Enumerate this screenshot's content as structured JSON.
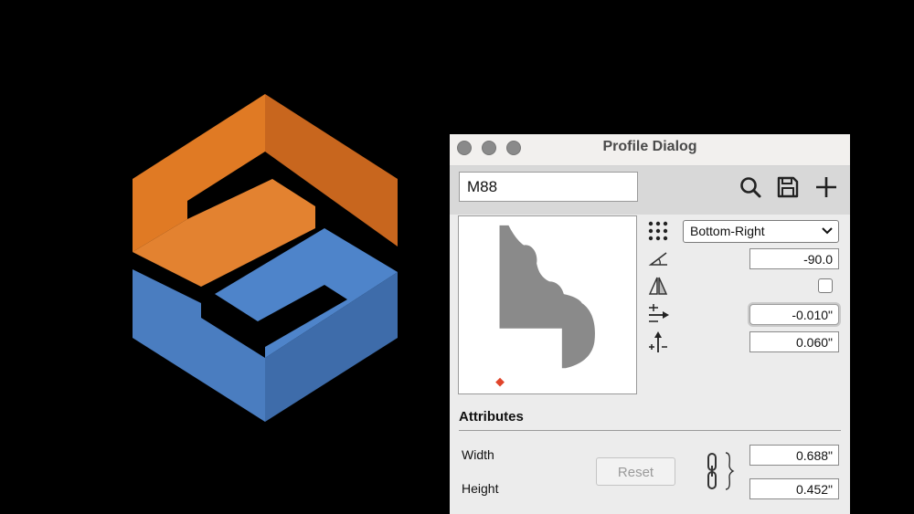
{
  "dialog": {
    "title": "Profile Dialog",
    "profile_name": "M88",
    "toolbar_icons": [
      "search-icon",
      "save-icon",
      "add-icon"
    ],
    "anchor": {
      "icon": "grid-dots-icon",
      "selected": "Bottom-Right"
    },
    "angle": {
      "icon": "angle-icon",
      "value": "-90.0"
    },
    "mirror": {
      "icon": "mirror-icon",
      "checked": false
    },
    "offset_x": {
      "icon": "horizontal-offset-icon",
      "value": "-0.010\""
    },
    "offset_y": {
      "icon": "vertical-offset-icon",
      "value": "0.060\""
    },
    "attributes": {
      "title": "Attributes",
      "width_label": "Width",
      "height_label": "Height",
      "reset_label": "Reset",
      "width_value": "0.688\"",
      "height_value": "0.452\"",
      "link_icon": "chain-link-icon"
    }
  },
  "colors": {
    "logo_orange": "#E07A24",
    "logo_blue": "#4A7DC0",
    "profile_fill": "#8a8a8a",
    "origin_marker": "#E0442A"
  }
}
